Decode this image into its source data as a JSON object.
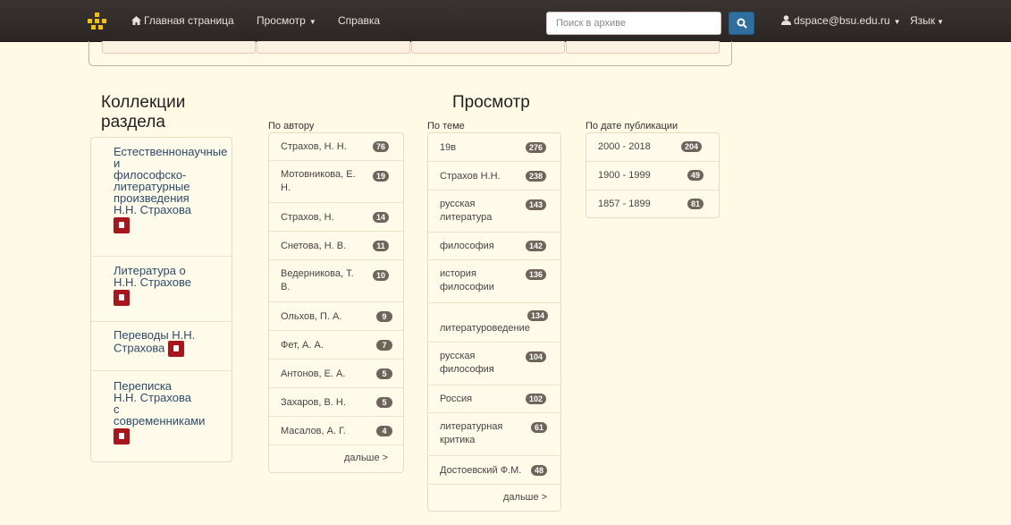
{
  "nav": {
    "home": "Главная страница",
    "browse": "Просмотр",
    "help": "Справка",
    "search_placeholder": "Поиск в архиве",
    "user": "dspace@bsu.edu.ru",
    "language": "Язык"
  },
  "collections": {
    "title_line1": "Коллекции",
    "title_line2": "раздела",
    "items": [
      {
        "lines": [
          "Естественнонаучные",
          "и",
          "философско-",
          "литературные",
          "произведения",
          "Н.Н. Страхова"
        ]
      },
      {
        "lines": [
          "Литература о",
          "Н.Н. Страхове"
        ]
      },
      {
        "lines": [
          "Переводы Н.Н.",
          "Страхова"
        ]
      },
      {
        "lines": [
          "Переписка",
          "Н.Н. Страхова",
          "с",
          "современниками"
        ]
      }
    ]
  },
  "browse": {
    "title": "Просмотр",
    "by_author": {
      "title": "По автору",
      "items": [
        {
          "label": "Страхов, Н. Н.",
          "count": "76"
        },
        {
          "label": "Мотовникова, Е. Н.",
          "count": "19"
        },
        {
          "label": "Страхов, Н.",
          "count": "14"
        },
        {
          "label": "Снетова, Н. В.",
          "count": "11"
        },
        {
          "label": "Ведерникова, Т. В.",
          "count": "10"
        },
        {
          "label": "Ольхов, П. А.",
          "count": "9"
        },
        {
          "label": "Фет, А. А.",
          "count": "7"
        },
        {
          "label": "Антонов, Е. А.",
          "count": "5"
        },
        {
          "label": "Захаров, В. Н.",
          "count": "5"
        },
        {
          "label": "Масалов, А. Г.",
          "count": "4"
        }
      ],
      "more": "дальше >"
    },
    "by_subject": {
      "title": "По теме",
      "items": [
        {
          "label": "19в",
          "count": "276"
        },
        {
          "label": "Страхов Н.Н.",
          "count": "238"
        },
        {
          "label": "русская литература",
          "count": "143"
        },
        {
          "label": "философия",
          "count": "142"
        },
        {
          "label": "история философии",
          "count": "136"
        },
        {
          "label": "литературоведение",
          "count": "134"
        },
        {
          "label": "русская философия",
          "count": "104"
        },
        {
          "label": "Россия",
          "count": "102"
        },
        {
          "label": "литературная критика",
          "count": "61"
        },
        {
          "label": "Достоевский Ф.М.",
          "count": "48"
        }
      ],
      "more": "дальше >"
    },
    "by_date": {
      "title": "По дате публикации",
      "items": [
        {
          "label": "2000 - 2018",
          "count": "204"
        },
        {
          "label": "1900 - 1999",
          "count": "49"
        },
        {
          "label": "1857 - 1899",
          "count": "81"
        }
      ]
    }
  }
}
